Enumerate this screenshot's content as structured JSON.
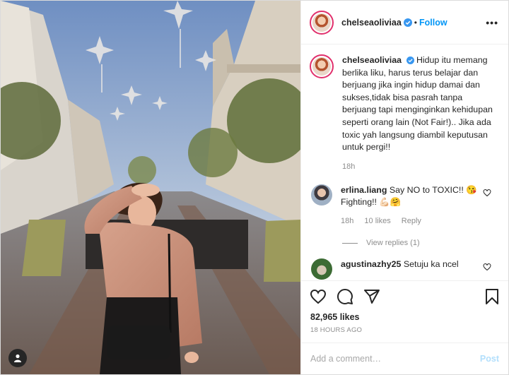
{
  "post": {
    "username": "chelseaoliviaa",
    "follow_label": "Follow",
    "separator": "•",
    "more_label": "•••",
    "caption": {
      "username": "chelseaoliviaa",
      "text": "Hidup itu memang berlika liku, harus terus belajar dan berjuang jika ingin hidup damai dan sukses,tidak bisa pasrah tanpa berjuang tapi menginginkan kehidupan seperti orang lain (Not Fair!).. Jika ada toxic yah langsung diambil keputusan untuk pergi!!",
      "time": "18h"
    },
    "comments": [
      {
        "username": "erlina.liang",
        "text": "Say NO to TOXIC!! 😘 Fighting!! 💪🏻🤗",
        "time": "18h",
        "likes": "10 likes",
        "reply_label": "Reply",
        "view_replies": "View replies (1)"
      },
      {
        "username": "agustinazhy25",
        "text": "Setuju ka ncel"
      }
    ],
    "likes": "82,965 likes",
    "timestamp": "18 HOURS AGO",
    "add_comment_placeholder": "Add a comment…",
    "post_button": "Post"
  },
  "icons": {
    "heart": "heart-icon",
    "comment": "comment-icon",
    "share": "share-icon",
    "save": "bookmark-icon",
    "user_tag": "user-tag-icon",
    "verified": "verified-badge-icon"
  },
  "colors": {
    "accent": "#0095f6",
    "verified": "#3897f0",
    "post_disabled": "#b2dffc",
    "muted": "#8e8e8e"
  }
}
